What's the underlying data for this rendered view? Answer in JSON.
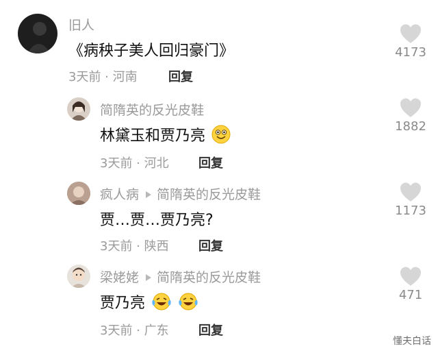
{
  "comments": [
    {
      "user": "旧人",
      "text": "《病秧子美人回归豪门》",
      "time": "3天前",
      "location": "河南",
      "reply_label": "回复",
      "likes": "4173"
    },
    {
      "user": "简隋英的反光皮鞋",
      "text": "林黛玉和贾乃亮",
      "emoji": "grinning-face-emoji",
      "time": "3天前",
      "location": "河北",
      "reply_label": "回复",
      "likes": "1882"
    },
    {
      "user": "疯人病",
      "reply_to": "简隋英的反光皮鞋",
      "text": "贾…贾…贾乃亮?",
      "time": "3天前",
      "location": "陕西",
      "reply_label": "回复",
      "likes": "1173"
    },
    {
      "user": "梁姥姥",
      "reply_to": "简隋英的反光皮鞋",
      "text": "贾乃亮",
      "emoji": "laughing-tears-emoji",
      "time": "3天前",
      "location": "广东",
      "reply_label": "回复",
      "likes": "471"
    }
  ],
  "meta_separator": " · ",
  "watermark": "懂夫白话",
  "colors": {
    "muted": "#9a9a9a",
    "heart": "#d6d6d6",
    "text": "#111111"
  }
}
